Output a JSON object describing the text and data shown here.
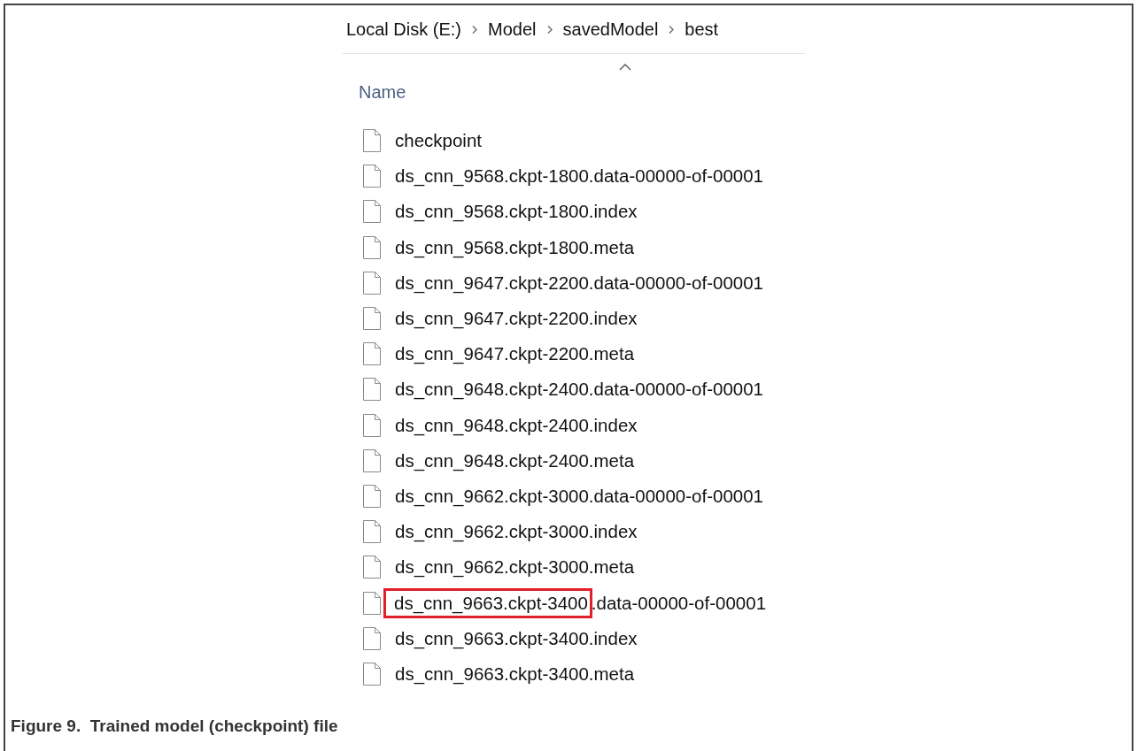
{
  "breadcrumb": [
    "Local Disk (E:)",
    "Model",
    "savedModel",
    "best"
  ],
  "column_header": {
    "label": "Name",
    "sort_ascending": true
  },
  "files": [
    {
      "name": "checkpoint"
    },
    {
      "name": "ds_cnn_9568.ckpt-1800.data-00000-of-00001"
    },
    {
      "name": "ds_cnn_9568.ckpt-1800.index"
    },
    {
      "name": "ds_cnn_9568.ckpt-1800.meta"
    },
    {
      "name": "ds_cnn_9647.ckpt-2200.data-00000-of-00001"
    },
    {
      "name": "ds_cnn_9647.ckpt-2200.index"
    },
    {
      "name": "ds_cnn_9647.ckpt-2200.meta"
    },
    {
      "name": "ds_cnn_9648.ckpt-2400.data-00000-of-00001"
    },
    {
      "name": "ds_cnn_9648.ckpt-2400.index"
    },
    {
      "name": "ds_cnn_9648.ckpt-2400.meta"
    },
    {
      "name": "ds_cnn_9662.ckpt-3000.data-00000-of-00001"
    },
    {
      "name": "ds_cnn_9662.ckpt-3000.index"
    },
    {
      "name": "ds_cnn_9662.ckpt-3000.meta"
    },
    {
      "highlighted": "ds_cnn_9663.ckpt-3400",
      "name": ".data-00000-of-00001"
    },
    {
      "name": "ds_cnn_9663.ckpt-3400.index"
    },
    {
      "name": "ds_cnn_9663.ckpt-3400.meta"
    }
  ],
  "caption": "Figure 9.  Trained model (checkpoint) file"
}
